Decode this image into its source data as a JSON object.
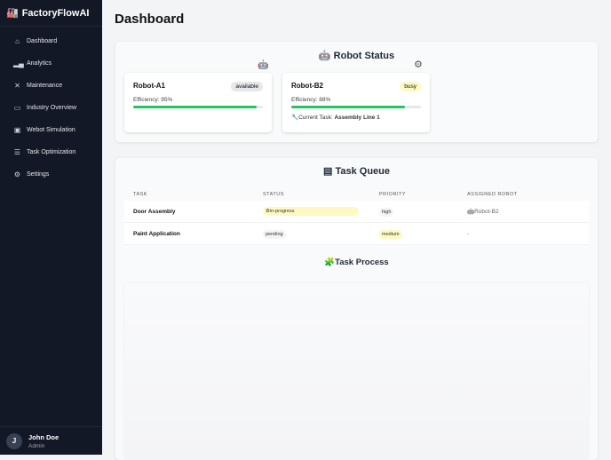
{
  "app": {
    "name": "FactoryFlowAI"
  },
  "sidebar": {
    "items": [
      {
        "label": "Dashboard",
        "icon": "home-icon"
      },
      {
        "label": "Analytics",
        "icon": "bar-chart-icon"
      },
      {
        "label": "Maintenance",
        "icon": "tools-icon"
      },
      {
        "label": "Industry Overview",
        "icon": "briefcase-icon"
      },
      {
        "label": "Webot Simulation",
        "icon": "cpu-icon"
      },
      {
        "label": "Task Optimization",
        "icon": "sliders-icon"
      },
      {
        "label": "Settings",
        "icon": "gear-icon"
      }
    ]
  },
  "user": {
    "initial": "J",
    "name": "John Doe",
    "role": "Admin"
  },
  "page": {
    "title": "Dashboard"
  },
  "robot_status": {
    "title": "Robot Status",
    "robots": [
      {
        "name": "Robot-A1",
        "status": "available",
        "efficiency_label": "Efficiency: 95%",
        "efficiency": 95
      },
      {
        "name": "Robot-B2",
        "status": "busy",
        "efficiency_label": "Efficiency: 88%",
        "efficiency": 88,
        "task_label": "Current Task:",
        "task": "Assembly Line 1"
      }
    ]
  },
  "task_queue": {
    "title": "Task Queue",
    "headers": [
      "TASK",
      "STATUS",
      "PRIORITY",
      "ASSIGNED ROBOT"
    ],
    "rows": [
      {
        "task": "Door Assembly",
        "status": "in-progress",
        "priority": "high",
        "robot": "Robot-B2"
      },
      {
        "task": "Paint Application",
        "status": "pending",
        "priority": "medium",
        "robot": "-"
      }
    ]
  },
  "task_process": {
    "title": "Task Process"
  },
  "colors": {
    "sidebar": "#121826",
    "progress": "#22c55e",
    "busy": "#fef9c3"
  }
}
